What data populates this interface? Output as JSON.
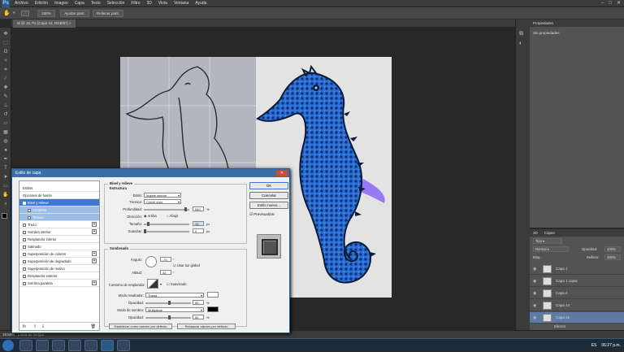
{
  "app": {
    "logo": "Ps"
  },
  "menu": [
    "Archivo",
    "Edición",
    "Imagen",
    "Capa",
    "Texto",
    "Selección",
    "Filtro",
    "3D",
    "Vista",
    "Ventana",
    "Ayuda"
  ],
  "options_bar": {
    "zoom": "100%",
    "fit": "Ajustar pant.",
    "fill": "Rellenar pant."
  },
  "tab": {
    "label": "af @ 18,7% (Capa 15, RGB/8*)"
  },
  "status": {
    "zoom": "18,56%",
    "hint": "Línea de tiempo"
  },
  "properties_panel": {
    "title": "Propiedades",
    "subtitle": "Sin propiedades"
  },
  "layers_panel": {
    "tabs": [
      "3D",
      "Capas"
    ],
    "kind": "Tipo",
    "blend": "Normal",
    "opacity_label": "Opacidad:",
    "opacity": "100%",
    "lock_label": "Bloq.:",
    "fill_label": "Relleno:",
    "fill": "100%",
    "layers": [
      {
        "name": "Capa 1"
      },
      {
        "name": "Capa 1 copia"
      },
      {
        "name": "Capa 4"
      },
      {
        "name": "Capa 14"
      },
      {
        "name": "Capa 15",
        "selected": true
      }
    ],
    "effects_label": "Efectos",
    "effect_item": "Bisel y relieve"
  },
  "dialog": {
    "title": "Estilo de capa",
    "styles": [
      {
        "label": "Estilos",
        "type": "header"
      },
      {
        "label": "Opciones de fusión",
        "type": "item"
      },
      {
        "label": "Bisel y relieve",
        "type": "selected",
        "checked": true
      },
      {
        "label": "Contorno",
        "type": "sub"
      },
      {
        "label": "Textura",
        "type": "sub"
      },
      {
        "label": "Trazo",
        "type": "check",
        "plus": true
      },
      {
        "label": "Sombra interior",
        "type": "check",
        "plus": true
      },
      {
        "label": "Resplandor interior",
        "type": "check"
      },
      {
        "label": "Satinado",
        "type": "check"
      },
      {
        "label": "Superposición de colores",
        "type": "check",
        "plus": true
      },
      {
        "label": "Superposición de degradado",
        "type": "check",
        "plus": true
      },
      {
        "label": "Superposición de motivo",
        "type": "check"
      },
      {
        "label": "Resplandor exterior",
        "type": "check"
      },
      {
        "label": "Sombra paralela",
        "type": "check",
        "plus": true
      }
    ],
    "footer_label": "fx",
    "structure": {
      "title": "Bisel y relieve",
      "subtitle": "Estructura",
      "style_label": "Estilo:",
      "style_value": "Inglete interior",
      "technique_label": "Técnica:",
      "technique_value": "Cincel duro",
      "depth_label": "Profundidad:",
      "depth_value": "540",
      "depth_unit": "%",
      "direction_label": "Dirección:",
      "dir_up": "Arriba",
      "dir_down": "Abajo",
      "size_label": "Tamaño:",
      "size_value": "10",
      "size_unit": "px",
      "soften_label": "Suavizar:",
      "soften_value": "0",
      "soften_unit": "px"
    },
    "shading": {
      "title": "Sombreado",
      "angle_label": "Ángulo:",
      "angle_value": "-70",
      "angle_unit": "°",
      "global_light": "Usar luz global",
      "altitude_label": "Altitud:",
      "altitude_value": "42",
      "altitude_unit": "°",
      "gloss_label": "Contorno de resplandor:",
      "antialias": "Suavizado",
      "highlight_mode_label": "Modo resaltador:",
      "highlight_mode": "Trama",
      "highlight_opacity_label": "Opacidad:",
      "highlight_opacity": "50",
      "highlight_opacity_unit": "%",
      "shadow_mode_label": "Modo de sombra:",
      "shadow_mode": "Multiplicar",
      "shadow_opacity_label": "Opacidad:",
      "shadow_opacity": "50",
      "shadow_opacity_unit": "%"
    },
    "make_default": "Establecer como valores por defecto",
    "reset_default": "Restaurar valores por defecto",
    "buttons": {
      "ok": "OK",
      "cancel": "Cancelar",
      "new_style": "Estilo nuevo...",
      "preview": "Previsualizar"
    }
  },
  "taskbar": {
    "lang": "ES",
    "time": "06:27 p.m."
  },
  "colors": {
    "accent": "#3b7ad0",
    "seahorse": "#2d6fd6"
  }
}
